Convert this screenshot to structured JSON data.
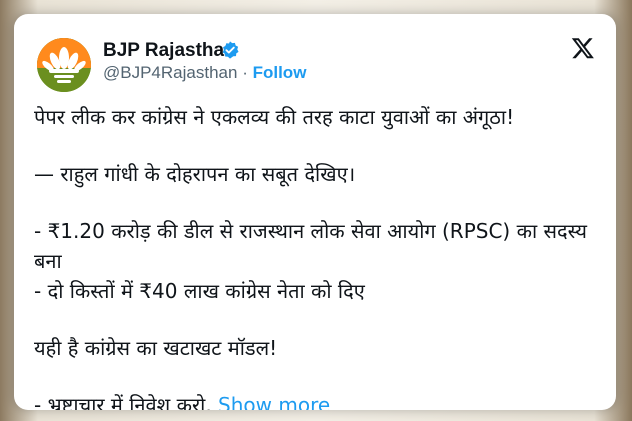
{
  "tweet": {
    "author_name": "BJP Rajasthan",
    "handle": "@BJP4Rajasthan",
    "separator": "·",
    "follow_label": "Follow",
    "lines": [
      "पेपर लीक कर कांग्रेस ने एकलव्य की तरह काटा युवाओं का अंगूठा!",
      "— राहुल गांधी के दोहरापन का सबूत देखिए।",
      "- ₹1.20 करोड़ की डील से राजस्थान लोक सेवा आयोग (RPSC) का सदस्य बना",
      "- दो किस्तों में ₹40 लाख कांग्रेस नेता को दिए",
      "यही है कांग्रेस का खटाखट मॉडल!",
      "- भ्रष्टाचार में निवेश करो,"
    ],
    "show_more_label": "Show more"
  },
  "icons": {
    "avatar": "bjp-lotus-logo",
    "verified": "verified-badge-icon",
    "platform": "x-logo-icon"
  },
  "colors": {
    "accent": "#1d9bf0",
    "text": "#0f1419",
    "secondary": "#536471"
  }
}
